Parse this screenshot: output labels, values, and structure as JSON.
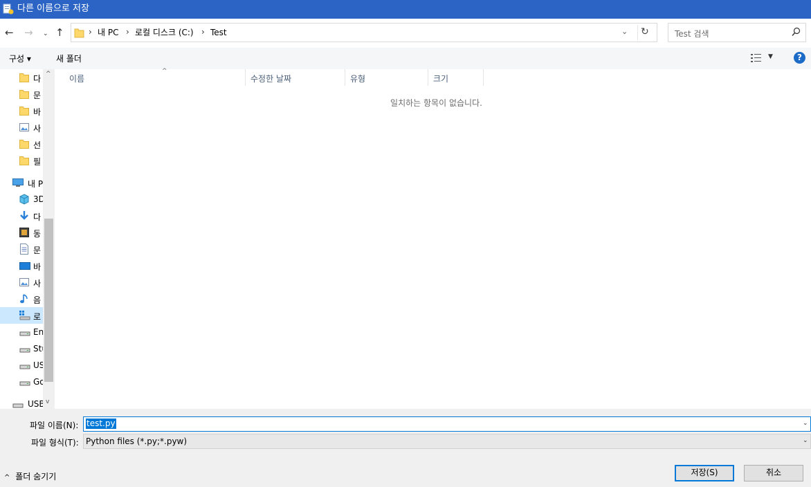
{
  "window": {
    "title": "다른 이름으로 저장"
  },
  "address": {
    "crumbs": [
      "내 PC",
      "로컬 디스크 (C:)",
      "Test"
    ],
    "search_placeholder": "Test 검색"
  },
  "toolbar": {
    "organize": "구성 ▾",
    "new_folder": "새 폴더",
    "help": "?"
  },
  "nav": {
    "items": [
      {
        "label": "다",
        "icon": "folder-icon"
      },
      {
        "label": "문",
        "icon": "folder-icon"
      },
      {
        "label": "바",
        "icon": "folder-icon"
      },
      {
        "label": "사",
        "icon": "pictures-icon"
      },
      {
        "label": "선",
        "icon": "folder-icon"
      },
      {
        "label": "필",
        "icon": "folder-icon"
      },
      {
        "label": "내 P",
        "icon": "this-pc-icon"
      },
      {
        "label": "3D",
        "icon": "3d-objects-icon"
      },
      {
        "label": "다",
        "icon": "downloads-icon"
      },
      {
        "label": "동",
        "icon": "videos-icon"
      },
      {
        "label": "문",
        "icon": "documents-icon"
      },
      {
        "label": "바",
        "icon": "desktop-icon"
      },
      {
        "label": "사",
        "icon": "pictures-icon"
      },
      {
        "label": "음",
        "icon": "music-icon"
      },
      {
        "label": "로",
        "icon": "local-disk-icon"
      },
      {
        "label": "En",
        "icon": "drive-icon"
      },
      {
        "label": "Stu",
        "icon": "drive-icon"
      },
      {
        "label": "US",
        "icon": "drive-icon"
      },
      {
        "label": "Go",
        "icon": "drive-icon"
      },
      {
        "label": "USB",
        "icon": "usb-drive-icon"
      }
    ]
  },
  "filelist": {
    "columns": [
      "이름",
      "수정한 날짜",
      "유형",
      "크기"
    ],
    "empty_message": "일치하는 항목이 없습니다."
  },
  "form": {
    "filename_label": "파일 이름(N):",
    "filename_value": "test.py",
    "filetype_label": "파일 형식(T):",
    "filetype_value": "Python files (*.py;*.pyw)"
  },
  "footer": {
    "hide_folders": "폴더 숨기기",
    "save_label": "저장(S)",
    "cancel_label": "취소"
  },
  "colors": {
    "titlebar": "#2b64c5",
    "accent": "#0078d7",
    "selected": "#cce8ff"
  }
}
